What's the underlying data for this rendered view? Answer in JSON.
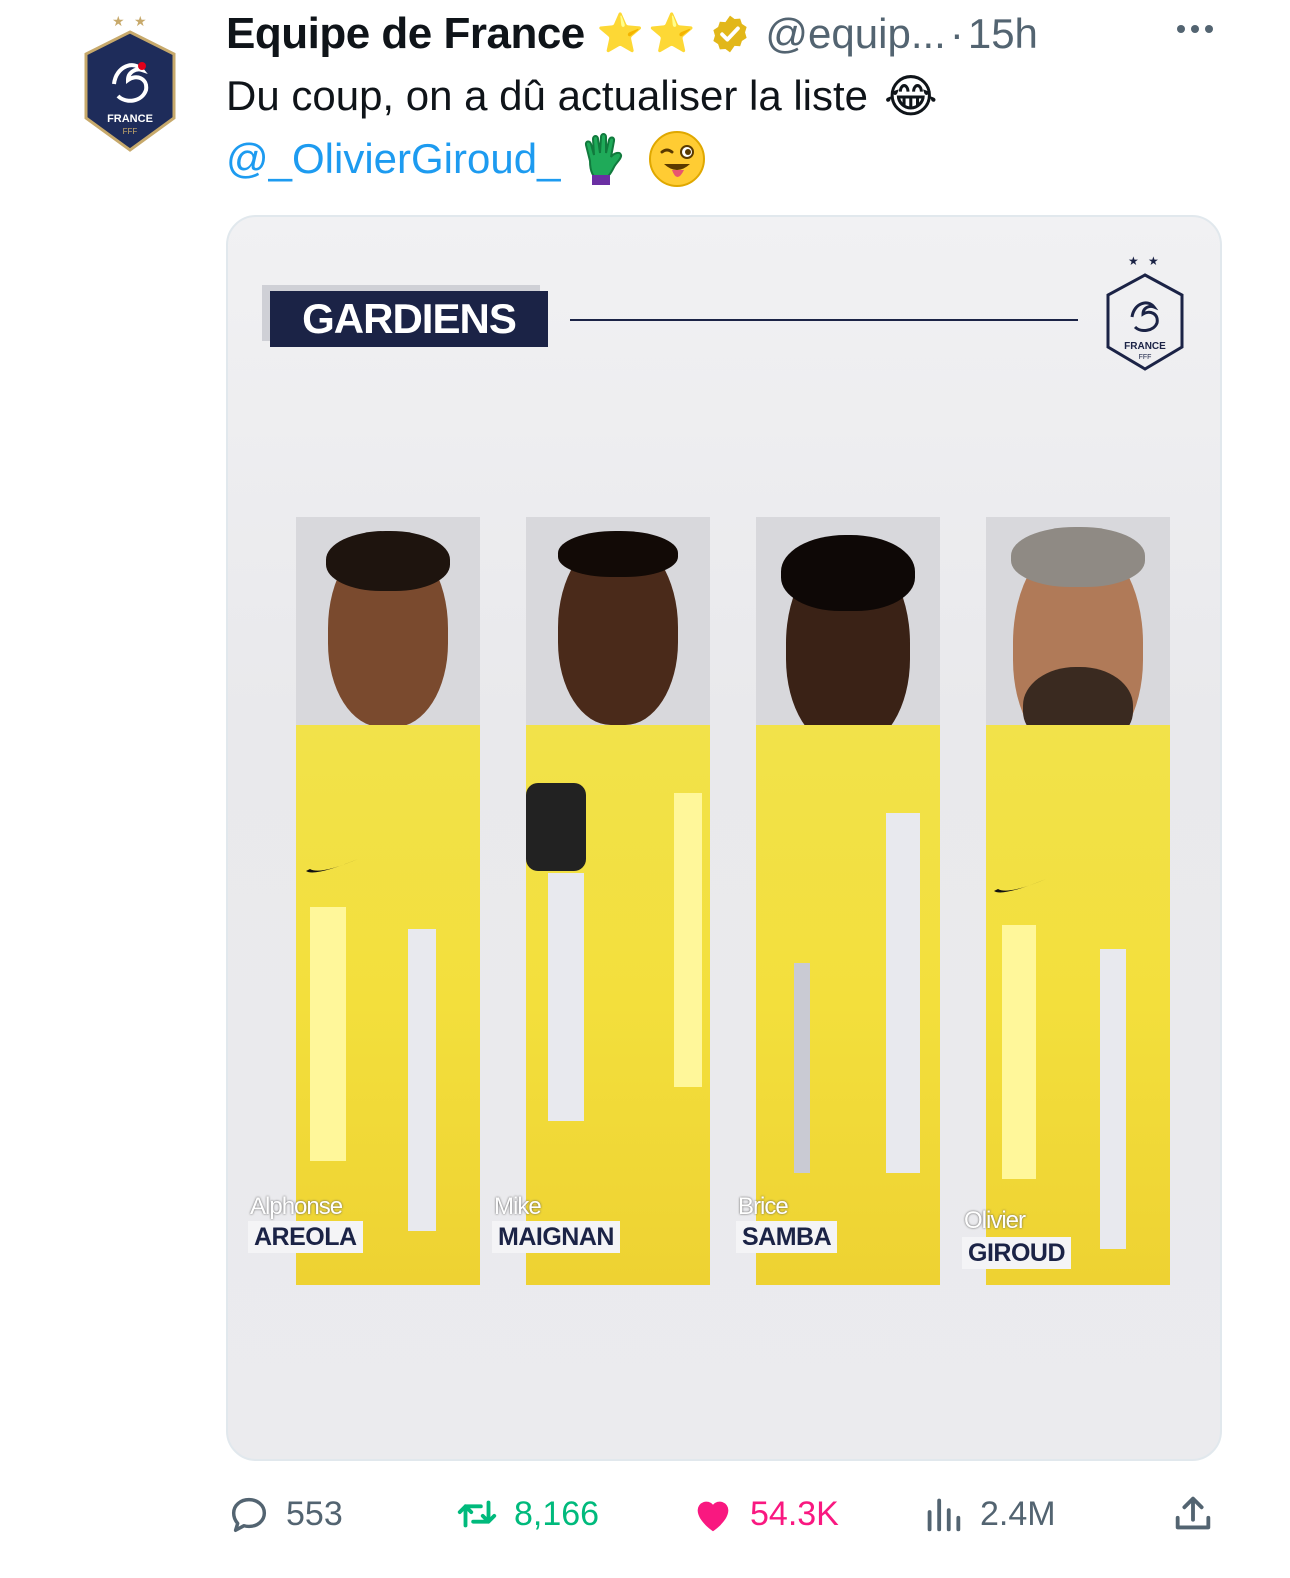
{
  "author": {
    "display_name": "Equipe de France",
    "name_emojis": [
      "⭐",
      "⭐"
    ],
    "handle": "@equip...",
    "separator": "·",
    "time": "15h",
    "avatar_text": "FRANCE",
    "avatar_subtext": "FFF"
  },
  "tweet": {
    "text": "Du coup, on a dû actualiser la liste",
    "text_emoji": "😂",
    "mention": "@_OlivierGiroud_"
  },
  "media": {
    "heading": "GARDIENS",
    "crest_text": "FRANCE",
    "crest_subtext": "FFF",
    "players": [
      {
        "first": "Alphonse",
        "last": "AREOLA"
      },
      {
        "first": "Mike",
        "last": "MAIGNAN"
      },
      {
        "first": "Brice",
        "last": "SAMBA"
      },
      {
        "first": "Olivier",
        "last": "GIROUD"
      }
    ]
  },
  "actions": {
    "replies": "553",
    "retweets": "8,166",
    "likes": "54.3K",
    "views": "2.4M"
  },
  "colors": {
    "text": "#0f1419",
    "secondary": "#536471",
    "link": "#1d9bf0",
    "retweet": "#00ba7c",
    "like": "#f91880",
    "navy": "#1b2346",
    "jersey_yellow": "#f3df3c"
  }
}
